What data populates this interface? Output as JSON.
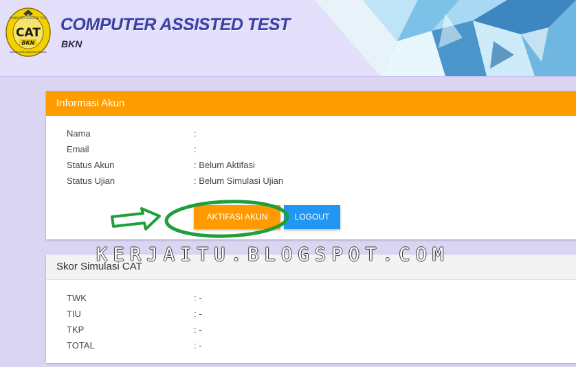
{
  "header": {
    "title": "COMPUTER ASSISTED TEST",
    "subtitle": "BKN",
    "logo": {
      "center_text": "CAT",
      "badge_text": "BKN",
      "ring_top_text": "COMPUTER ASSISTED TEST",
      "ring_bottom_text": "BADAN KEPEGAWAIAN NEGARA"
    }
  },
  "account_panel": {
    "title": "Informasi Akun",
    "rows": [
      {
        "label": "Nama",
        "value": ":"
      },
      {
        "label": "Email",
        "value": ":"
      },
      {
        "label": "Status Akun",
        "value": ": Belum Aktifasi"
      },
      {
        "label": "Status Ujian",
        "value": ": Belum Simulasi Ujian"
      }
    ],
    "activate_button": "AKTIFASI AKUN",
    "logout_button": "LOGOUT"
  },
  "score_panel": {
    "title": "Skor Simulasi CAT",
    "rows": [
      {
        "label": "TWK",
        "value": ": -"
      },
      {
        "label": "TIU",
        "value": ": -"
      },
      {
        "label": "TKP",
        "value": ": -"
      },
      {
        "label": "TOTAL",
        "value": ": -"
      }
    ]
  },
  "watermark": "KERJAITU.BLOGSPOT.COM",
  "colors": {
    "background": "#d9d5f3",
    "panel_header_orange": "#ff9d00",
    "activate_button": "#ff9a00",
    "logout_button": "#2196f3",
    "annotation_green": "#1f9e3a"
  }
}
